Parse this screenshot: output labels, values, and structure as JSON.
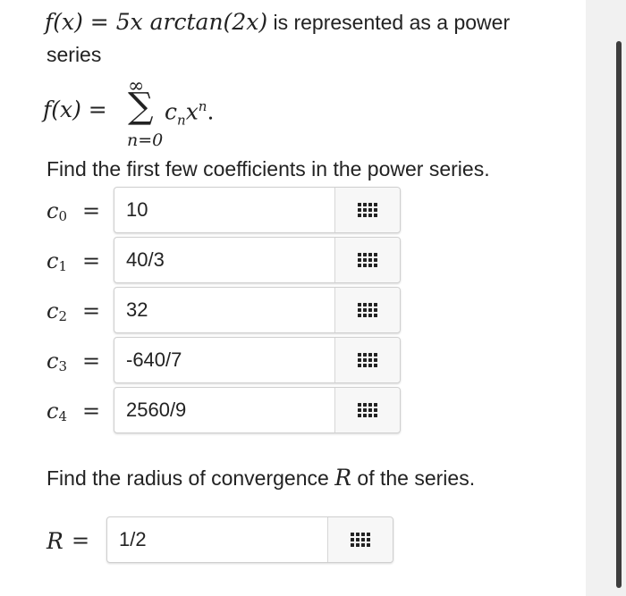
{
  "problem": {
    "intro_lhs": "f(x) = 5x arctan(2x)",
    "intro_rest": "is represented as a power",
    "intro_line2": "series",
    "series_lhs": "f(x) =",
    "sigma": "∑",
    "sum_top": "∞",
    "sum_bottom": "n=0",
    "summand": "c",
    "summand_sub": "n",
    "summand_x": "x",
    "summand_pow": "n",
    "summand_end": ".",
    "coef_prompt": "Find the first few coefficients in the power series.",
    "radius_prompt_a": "Find the radius of convergence",
    "radius_var": "R",
    "radius_prompt_b": "of the series."
  },
  "coefficients": [
    {
      "label": "c",
      "sub": "0",
      "value": "10"
    },
    {
      "label": "c",
      "sub": "1",
      "value": "40/3"
    },
    {
      "label": "c",
      "sub": "2",
      "value": "32"
    },
    {
      "label": "c",
      "sub": "3",
      "value": "-640/7"
    },
    {
      "label": "c",
      "sub": "4",
      "value": "2560/9"
    }
  ],
  "equals": "=",
  "radius": {
    "label": "R",
    "equals": "=",
    "value": "1/2"
  },
  "icons": {
    "keyboard": "keyboard-grid-icon"
  }
}
